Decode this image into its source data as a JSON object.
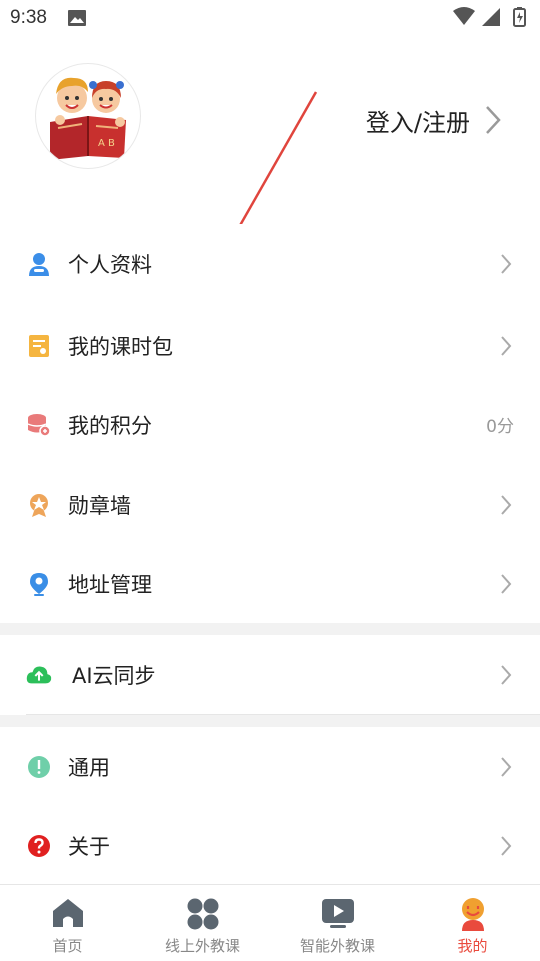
{
  "status_bar": {
    "time": "9:38"
  },
  "header": {
    "login_label": "登入/注册"
  },
  "menu": {
    "profile": "个人资料",
    "lesson_package": "我的课时包",
    "points": "我的积分",
    "points_value": "0分",
    "badges": "勋章墙",
    "address": "地址管理",
    "ai_sync": "AI云同步",
    "general": "通用",
    "about": "关于"
  },
  "tabbar": {
    "home": "首页",
    "online_courses": "线上外教课",
    "smart_courses": "智能外教课",
    "mine": "我的"
  },
  "colors": {
    "accent_red": "#e94a3d",
    "annotation_arrow": "#e0453d",
    "profile_icon": "#3b8ee8",
    "lesson_icon": "#f5b540",
    "points_icon": "#e97a7a",
    "badge_icon": "#eea55a",
    "address_icon": "#3a8ee6",
    "cloud_icon": "#2cbf5a",
    "general_icon": "#6fcfa9",
    "about_icon": "#e02020"
  }
}
